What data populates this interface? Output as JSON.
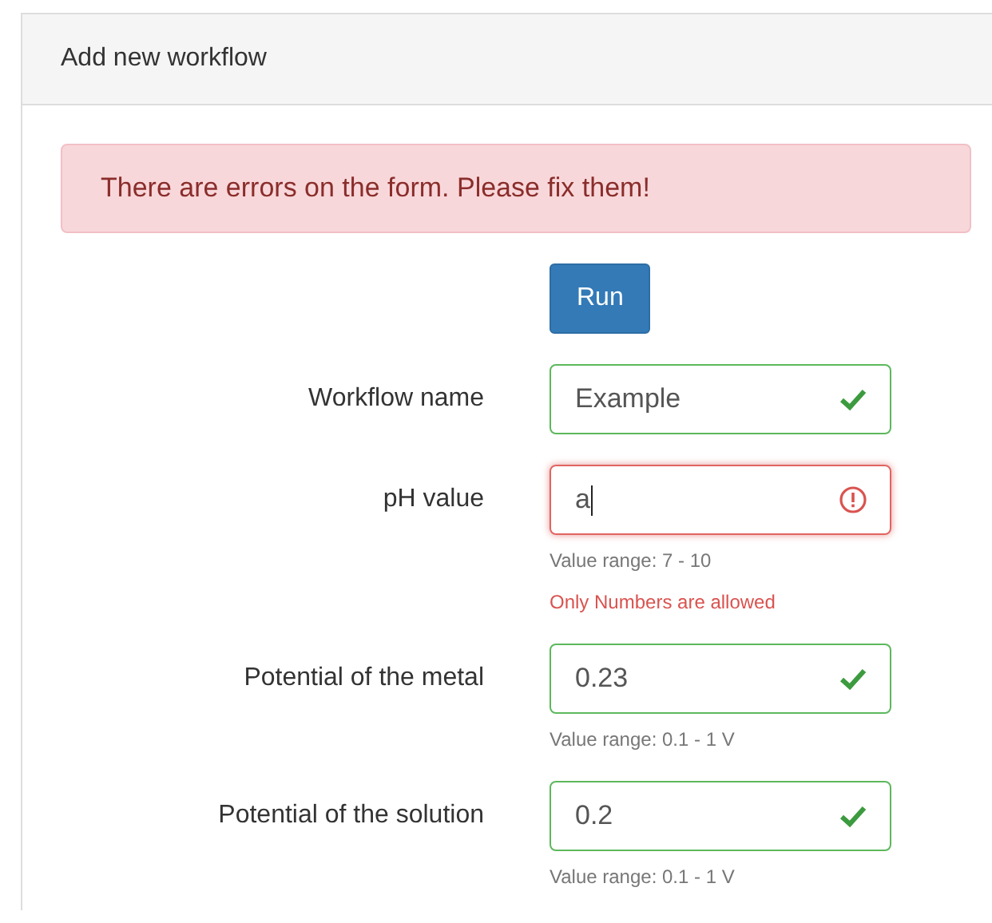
{
  "panel": {
    "title": "Add new workflow"
  },
  "alert": {
    "text": "There are errors on the form. Please fix them!"
  },
  "run_button": {
    "label": "Run"
  },
  "fields": [
    {
      "label": "Workflow name",
      "value": "Example",
      "valid": true,
      "focused": false
    },
    {
      "label": "pH value",
      "value": "a",
      "valid": false,
      "focused": true,
      "help": "Value range: 7 - 10",
      "error": "Only Numbers are allowed"
    },
    {
      "label": "Potential of the metal",
      "value": "0.23",
      "valid": true,
      "focused": false,
      "help": "Value range: 0.1 - 1 V"
    },
    {
      "label": "Potential of the solution",
      "value": "0.2",
      "valid": true,
      "focused": false,
      "help": "Value range: 0.1 - 1 V"
    }
  ]
}
